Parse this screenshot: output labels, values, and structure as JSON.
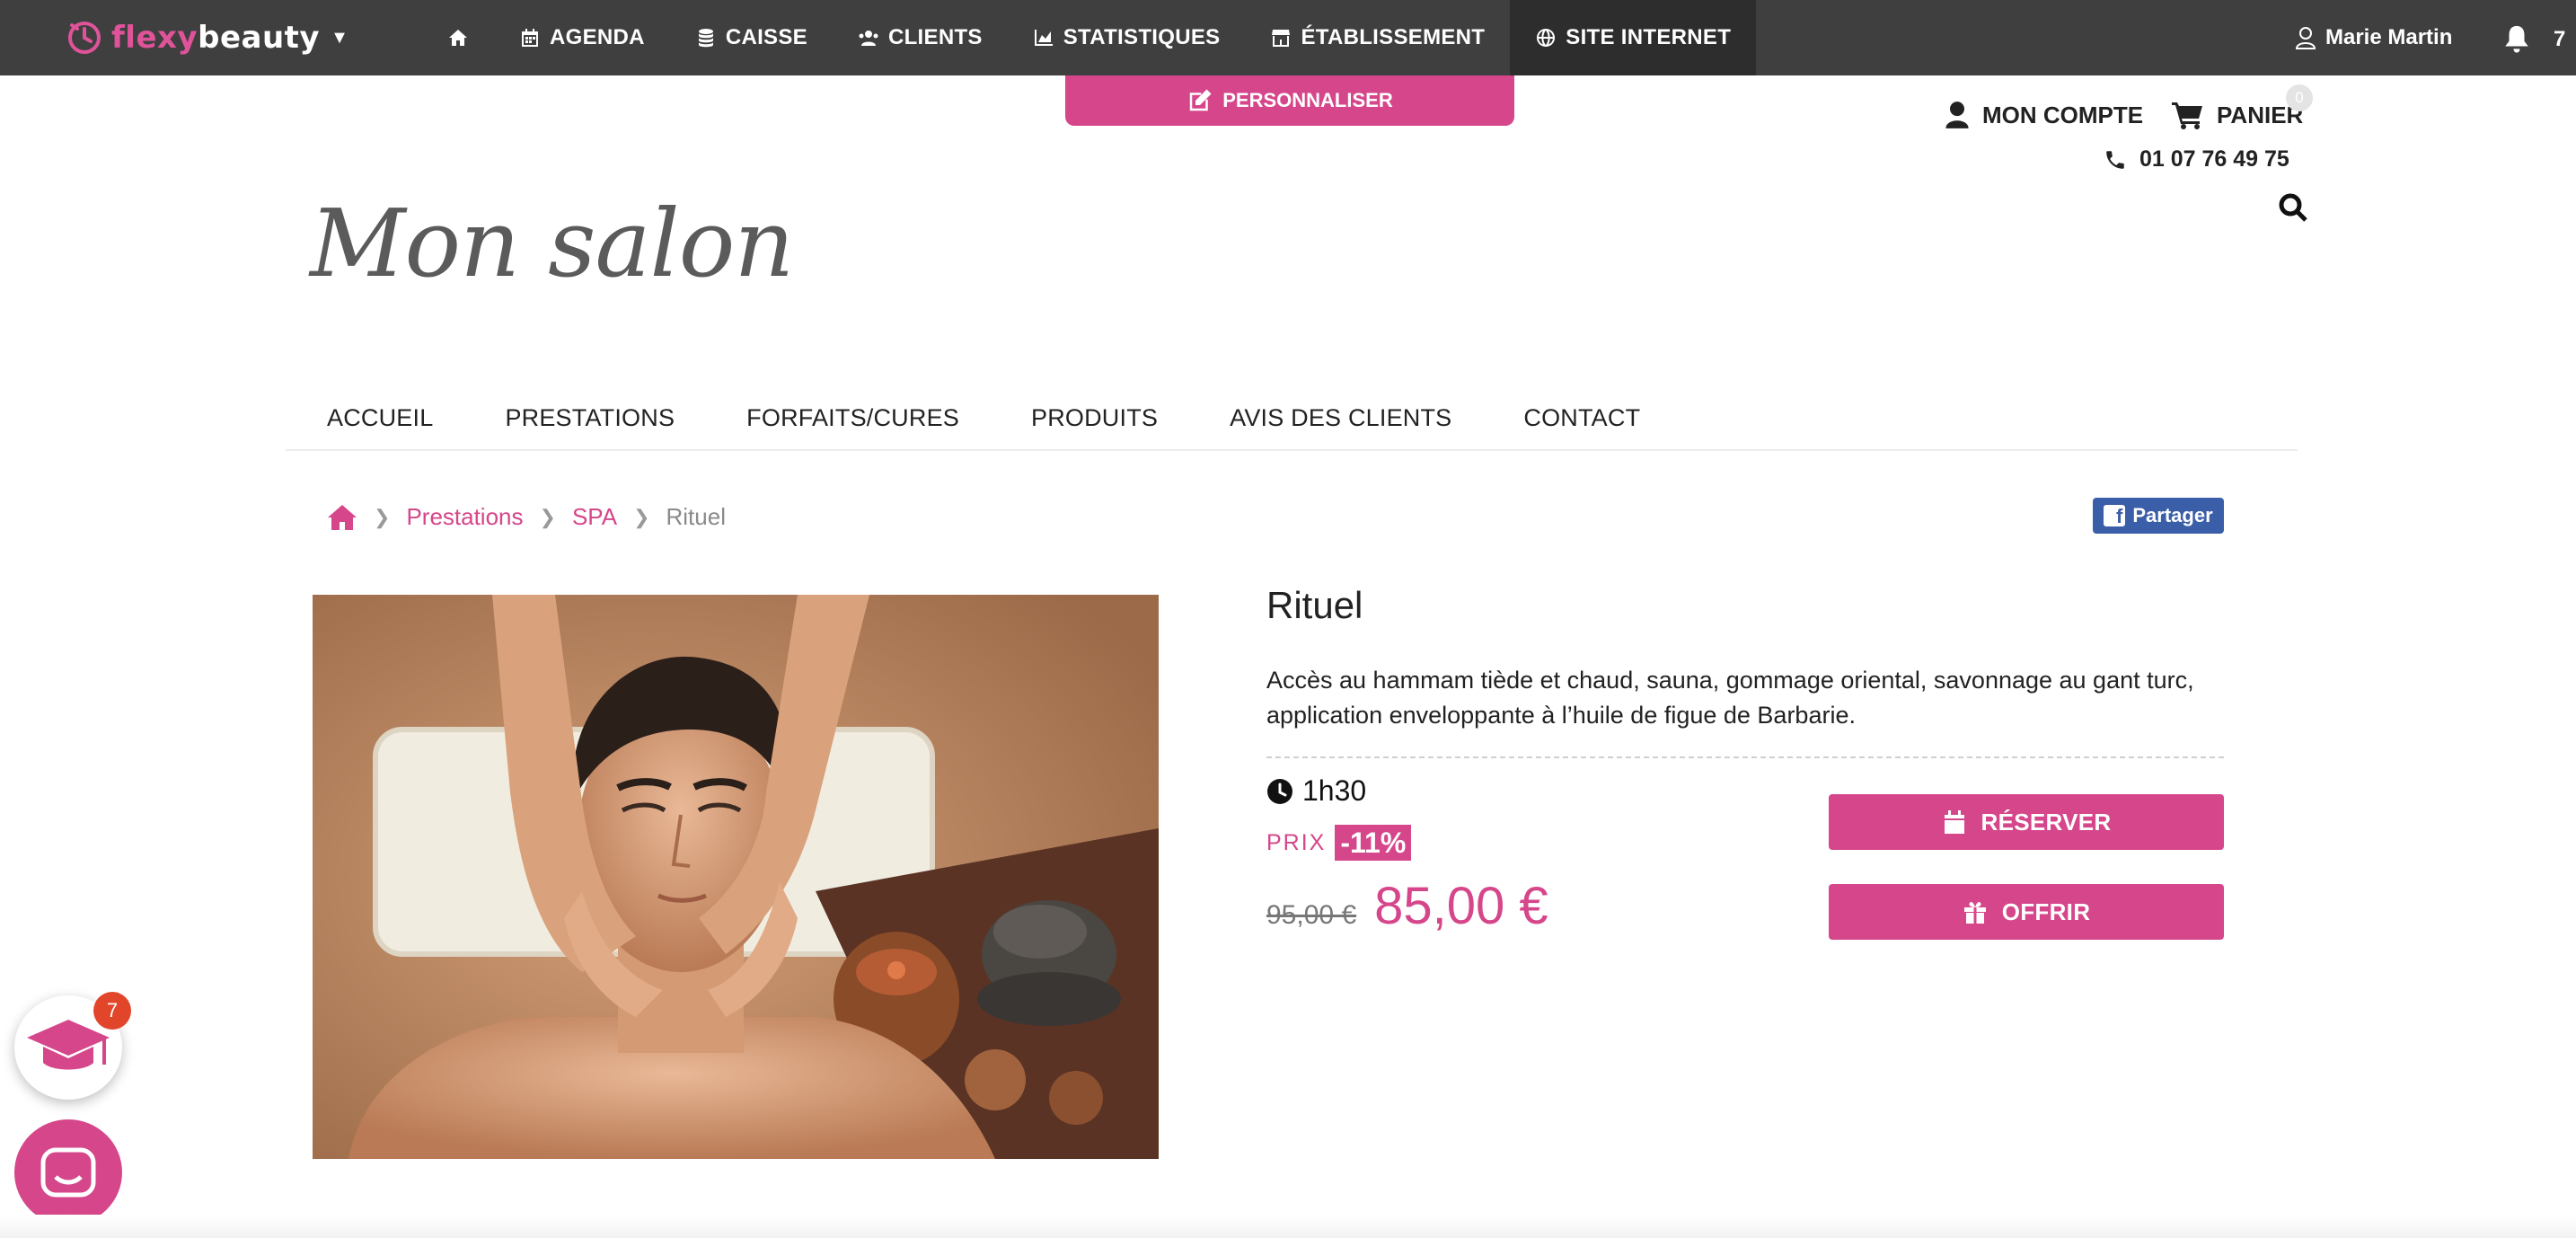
{
  "app": {
    "brand_prefix": "flexy",
    "brand_suffix": "beauty",
    "nav": [
      {
        "label": "AGENDA"
      },
      {
        "label": "CAISSE"
      },
      {
        "label": "CLIENTS"
      },
      {
        "label": "STATISTIQUES"
      },
      {
        "label": "ÉTABLISSEMENT"
      },
      {
        "label": "SITE INTERNET"
      }
    ],
    "user_name": "Marie Martin",
    "notification_count": "7",
    "personnaliser_label": "PERSONNALISER"
  },
  "site": {
    "account_label": "MON COMPTE",
    "cart_label": "PANIER",
    "cart_count": "0",
    "phone": "01 07 76 49 75",
    "salon_name": "Mon salon",
    "menu": [
      "ACCUEIL",
      "PRESTATIONS",
      "FORFAITS/CURES",
      "PRODUITS",
      "AVIS DES CLIENTS",
      "CONTACT"
    ]
  },
  "breadcrumb": {
    "items": [
      "Prestations",
      "SPA"
    ],
    "current": "Rituel"
  },
  "share_label": "Partager",
  "product": {
    "title": "Rituel",
    "description": "Accès au hammam tiède et chaud, sauna, gommage oriental, savonnage au gant turc, application enveloppante à l’huile de figue de Barbarie.",
    "duration": "1h30",
    "price_label": "PRIX",
    "discount": "-11%",
    "old_price": "95,00 €",
    "new_price": "85,00 €",
    "reserve_label": "RÉSERVER",
    "gift_label": "OFFRIR"
  },
  "widgets": {
    "academy_badge": "7"
  },
  "colors": {
    "accent": "#d5468a",
    "topbar": "#3f3f3f",
    "facebook": "#3b5ea9"
  }
}
